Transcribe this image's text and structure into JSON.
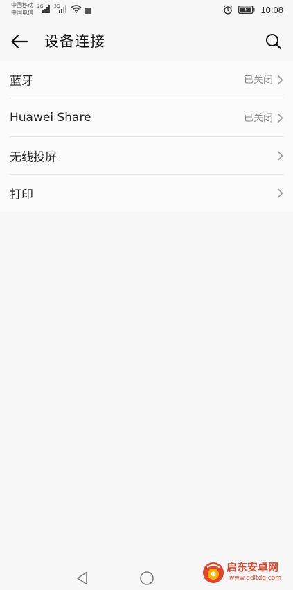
{
  "status_bar": {
    "carrier_1": "中国移动",
    "carrier_2": "中国电信",
    "sig1_tag": "2G",
    "sig2_tag": "3G",
    "time": "10:08",
    "icons": [
      "signal-icon",
      "signal-icon",
      "wifi-icon",
      "notification-icon",
      "alarm-icon",
      "battery-icon"
    ]
  },
  "header": {
    "title": "设备连接",
    "back_icon": "arrow-left-icon",
    "search_icon": "search-icon"
  },
  "settings_list": [
    {
      "label": "蓝牙",
      "status": "已关闭"
    },
    {
      "label": "Huawei Share",
      "status": "已关闭"
    },
    {
      "label": "无线投屏",
      "status": ""
    },
    {
      "label": "打印",
      "status": ""
    }
  ],
  "nav_bar": {
    "icons": [
      "back-triangle-icon",
      "home-circle-icon"
    ]
  },
  "watermark": {
    "name": "启东安卓网",
    "url": "www.qdltdq.com"
  },
  "colors": {
    "background": "#f7f7f7",
    "list_background": "#fbfbfb",
    "secondary_text": "#8a8a8a",
    "divider": "#e6e6e6",
    "watermark": "#e0452b"
  }
}
